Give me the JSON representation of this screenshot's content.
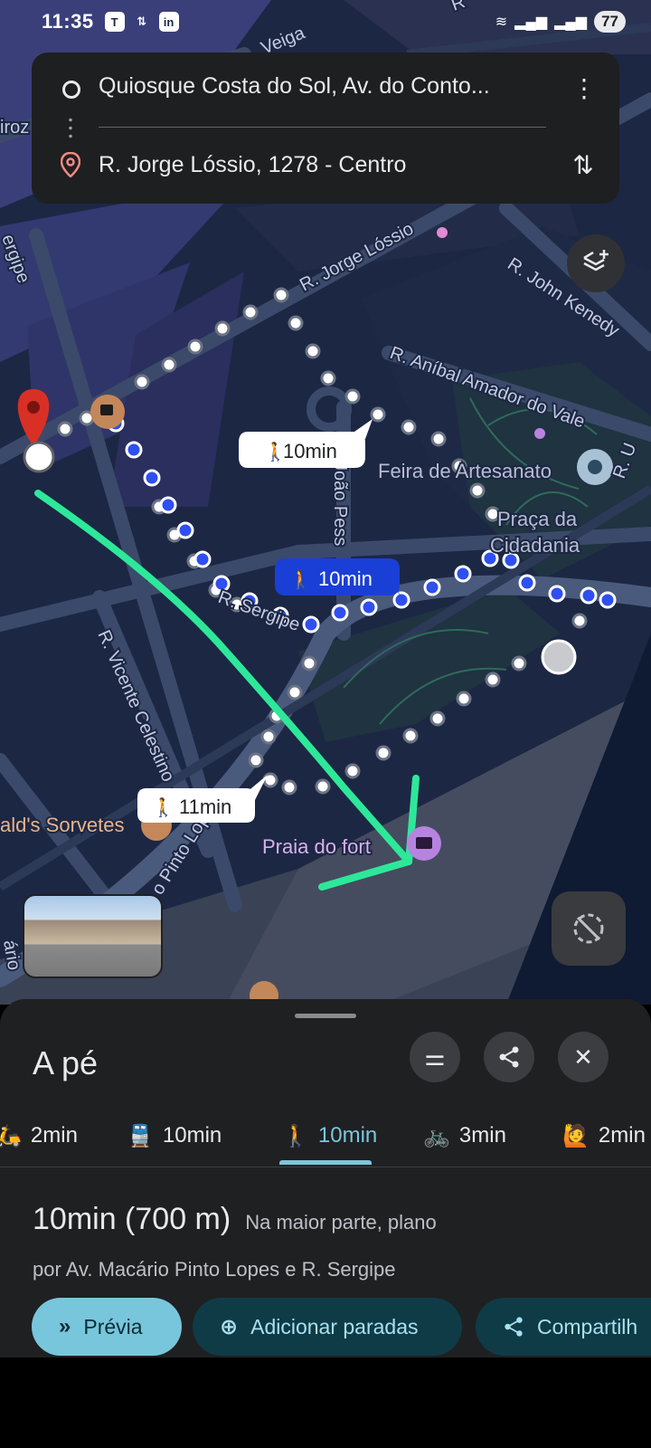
{
  "status_bar": {
    "time": "11:35",
    "notification_icons": [
      "tasks-icon",
      "ab-icon",
      "linkedin-icon"
    ],
    "network": "wifi-5-icon",
    "battery": "77"
  },
  "search": {
    "origin": "Quiosque Costa do Sol, Av. do Conto...",
    "destination": "R. Jorge Lóssio, 1278 - Centro"
  },
  "map": {
    "street_labels": {
      "jorge_lossio": "R. Jorge Lóssio",
      "john_kennedy": "R. John Kenedy",
      "anibal": "R. Aníbal Amador do Vale",
      "sergipe": "R. Sergipe",
      "joao_pessoa": "João Pess",
      "vicente": "R. Vicente Celestino",
      "pinto_lopes": "o Pinto Lopes",
      "veiga": "Veiga",
      "sergipe_left": "ergipe",
      "iroz": "iroz",
      "rio": "ário",
      "u": "R. U",
      "top_r": "R"
    },
    "places": {
      "feira": "Feira de Artesanato",
      "praca_line1": "Praça da",
      "praca_line2": "Cidadania",
      "sorvetes": "ald's Sorvetes",
      "praia": "Praia do fort"
    },
    "route_labels": {
      "alt1": "10min",
      "selected": "10min",
      "alt2": "11min"
    },
    "accent_route": "#3b5bf5",
    "alt_route_dots": "#ffffff",
    "annotation_color": "#2ee89a"
  },
  "sheet": {
    "title": "A pé",
    "tabs": [
      {
        "icon": "motorcycle-icon",
        "label": "2min"
      },
      {
        "icon": "transit-icon",
        "label": "10min"
      },
      {
        "icon": "walk-icon",
        "label": "10min",
        "active": true
      },
      {
        "icon": "bike-icon",
        "label": "3min"
      },
      {
        "icon": "ride-icon",
        "label": "2min"
      }
    ],
    "route_time": "10min (700 m)",
    "route_terrain": "Na maior parte, plano",
    "route_via": "por Av. Macário Pinto Lopes e R. Sergipe",
    "buttons": {
      "preview": "Prévia",
      "add_stops": "Adicionar paradas",
      "share": "Compartilh"
    }
  }
}
